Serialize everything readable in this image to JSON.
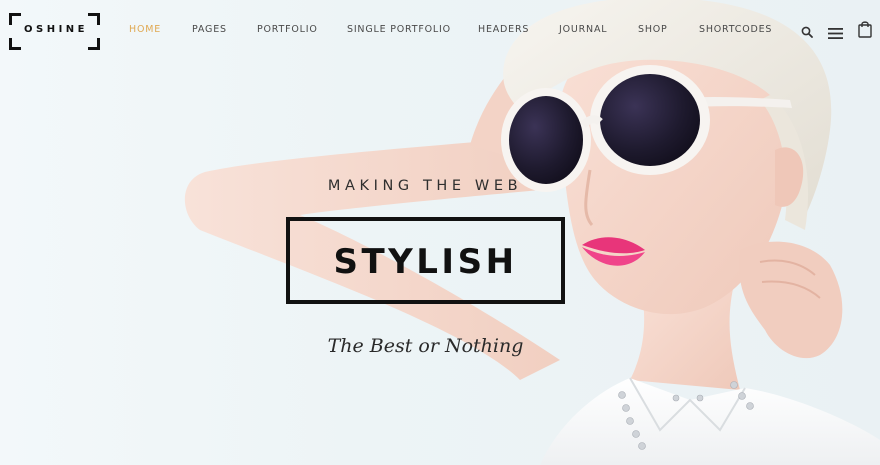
{
  "logo": {
    "text": "OSHINE"
  },
  "nav": {
    "items": [
      {
        "label": "HOME",
        "active": true
      },
      {
        "label": "PAGES",
        "active": false
      },
      {
        "label": "PORTFOLIO",
        "active": false
      },
      {
        "label": "SINGLE PORTFOLIO",
        "active": false
      },
      {
        "label": "HEADERS",
        "active": false
      },
      {
        "label": "JOURNAL",
        "active": false
      },
      {
        "label": "SHOP",
        "active": false
      },
      {
        "label": "SHORTCODES",
        "active": false
      }
    ],
    "icons": [
      "search-icon",
      "menu-icon",
      "shopping-bag-icon"
    ]
  },
  "hero": {
    "eyebrow": "MAKING THE WEB",
    "title": "STYLISH",
    "tagline": "The Best or Nothing"
  },
  "colors": {
    "accent": "#e0a953",
    "text_dark": "#111111",
    "nav_text": "#4a4a4a",
    "background": "#eef5f7",
    "lipstick": "#e8357a"
  }
}
